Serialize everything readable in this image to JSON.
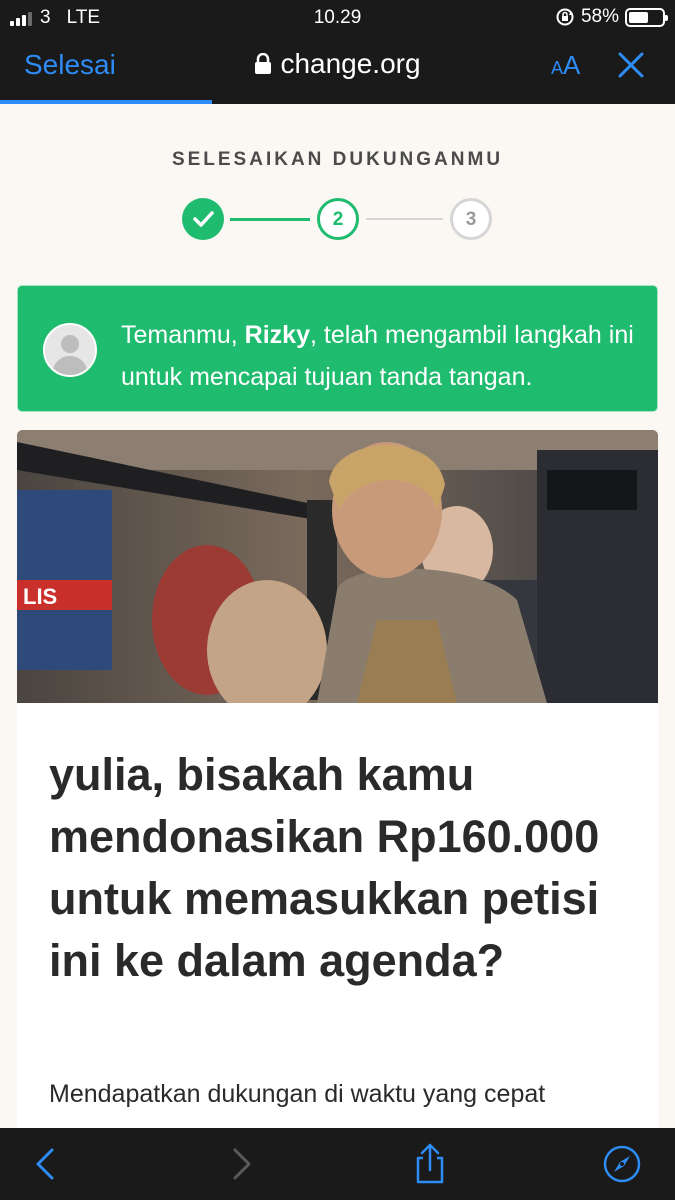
{
  "status_bar": {
    "carrier": "3",
    "network": "LTE",
    "time": "10.29",
    "battery_percent": "58%",
    "battery_level": 0.58,
    "icons": [
      "signal-icon",
      "rotation-lock-icon",
      "battery-icon"
    ]
  },
  "browser": {
    "done_label": "Selesai",
    "url": "change.org",
    "aa_label_small": "A",
    "aa_label_large": "A",
    "accent_color": "#2d8cf5",
    "icons": [
      "lock-icon",
      "close-icon",
      "back-icon",
      "forward-icon",
      "share-icon",
      "compass-icon"
    ]
  },
  "steps": {
    "title": "SELESAIKAN DUKUNGANMU",
    "items": [
      {
        "label": "",
        "state": "done"
      },
      {
        "label": "2",
        "state": "current"
      },
      {
        "label": "3",
        "state": "upcoming"
      }
    ],
    "accent_color": "#1fbb6f"
  },
  "banner": {
    "text_before": "Temanmu, ",
    "friend_name": "Rizky",
    "text_after": ", telah mengambil langkah ini untuk mencapai tujuan tanda tangan."
  },
  "petition": {
    "headline": "yulia, bisakah kamu mendonasikan Rp160.000 untuk memasukkan petisi ini ke dalam agenda?",
    "subtext": "Mendapatkan dukungan di waktu yang cepat"
  }
}
